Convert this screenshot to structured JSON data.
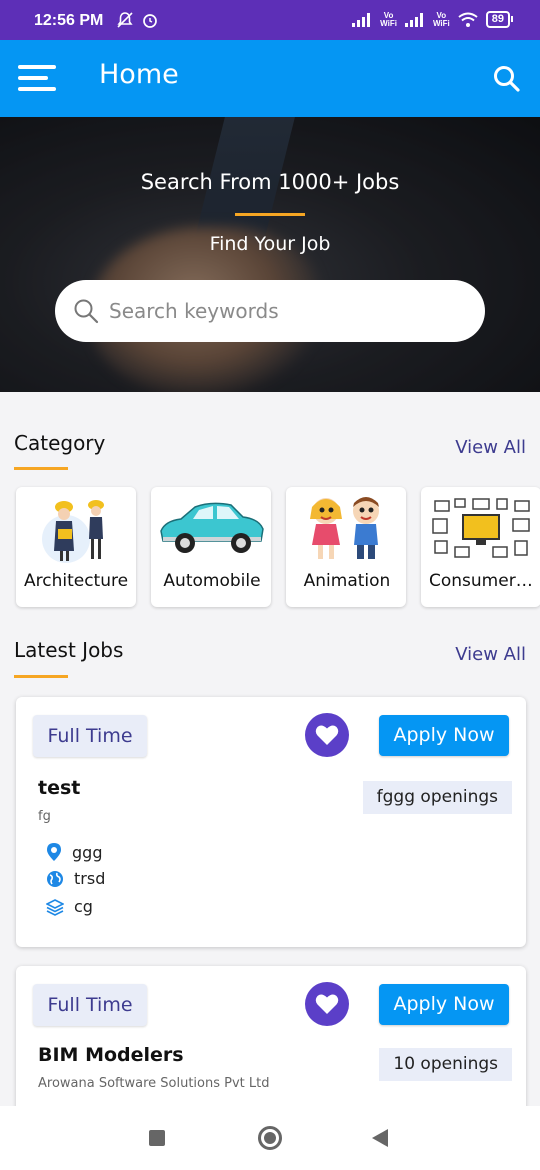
{
  "status_bar": {
    "time": "12:56 PM",
    "vo_wifi_1": "Vo\nWiFi",
    "vo_wifi_2": "Vo\nWiFi",
    "battery": "89"
  },
  "app_bar": {
    "title": "Home"
  },
  "hero": {
    "title": "Search From 1000+ Jobs",
    "subtitle": "Find Your Job",
    "search_placeholder": "Search keywords"
  },
  "category": {
    "heading": "Category",
    "view_all": "View All",
    "items": [
      {
        "label": "Architecture",
        "icon": "architect-women-icon"
      },
      {
        "label": "Automobile",
        "icon": "car-icon"
      },
      {
        "label": "Animation",
        "icon": "cartoon-kids-icon"
      },
      {
        "label": "Consumer Electronics",
        "icon": "electronics-icon"
      }
    ]
  },
  "latest_jobs": {
    "heading": "Latest Jobs",
    "view_all": "View All",
    "jobs": [
      {
        "type": "Full Time",
        "apply_label": "Apply Now",
        "title": "test",
        "company": "fg",
        "openings": "fggg  openings",
        "location": "ggg",
        "region": "trsd",
        "category": "cg"
      },
      {
        "type": "Full Time",
        "apply_label": "Apply Now",
        "title": "BIM Modelers",
        "company": "Arowana Software Solutions Pvt Ltd",
        "openings": "10  openings"
      }
    ]
  },
  "colors": {
    "status_bar": "#5d2fb7",
    "app_bar": "#0596f3",
    "accent": "#f6a623",
    "heart": "#5b3fc8",
    "link": "#3d3b8f"
  }
}
